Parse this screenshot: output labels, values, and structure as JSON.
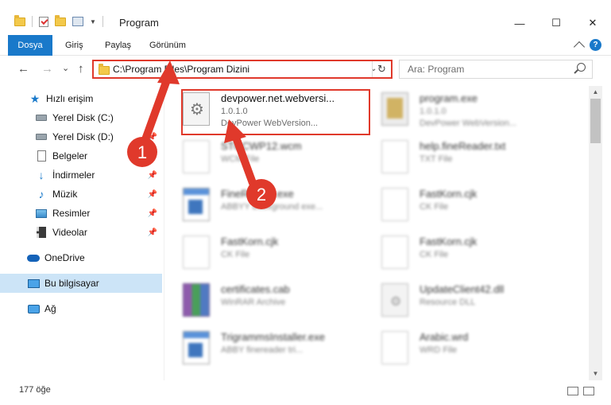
{
  "window": {
    "title": "Program",
    "minimize_label": "—",
    "maximize_label": "☐",
    "close_label": "✕"
  },
  "ribbon": {
    "tabs": [
      "Dosya",
      "Giriş",
      "Paylaş",
      "Görünüm"
    ],
    "help_label": "?"
  },
  "navigation": {
    "back_label": "←",
    "forward_label": "→",
    "recent_label": "⌄",
    "up_label": "↑",
    "address": "C:\\Program Files\\Program Dizini",
    "refresh_label": "↻",
    "dropdown_label": "⌄",
    "search_placeholder": "Ara: Program"
  },
  "sidebar": {
    "items": [
      {
        "label": "Hızlı erişim",
        "icon": "star-icon"
      },
      {
        "label": "Yerel Disk (C:)",
        "icon": "disk-icon"
      },
      {
        "label": "Yerel Disk (D:)",
        "icon": "disk-icon"
      },
      {
        "label": "Belgeler",
        "icon": "documents-icon"
      },
      {
        "label": "İndirmeler",
        "icon": "downloads-icon"
      },
      {
        "label": "Müzik",
        "icon": "music-icon"
      },
      {
        "label": "Resimler",
        "icon": "pictures-icon"
      },
      {
        "label": "Videolar",
        "icon": "videos-icon"
      },
      {
        "label": "OneDrive",
        "icon": "onedrive-icon"
      },
      {
        "label": "Bu bilgisayar",
        "icon": "computer-icon"
      },
      {
        "label": "Ağ",
        "icon": "network-icon"
      }
    ],
    "pin_label": "📌"
  },
  "files": [
    {
      "name": "devpower.net.webversi...",
      "line2": "1.0.1.0",
      "line3": "DevPower WebVersion...",
      "icon": "gears-file-icon"
    },
    {
      "name": "program.exe",
      "line2": "1.0.1.0",
      "line3": "DevPower WebVersion...",
      "icon": "exe-icon"
    },
    {
      "name": "STOCWP12.wcm",
      "line2": "WCM File",
      "line3": "",
      "icon": "generic-file-icon"
    },
    {
      "name": "help.fineReader.txt",
      "line2": "TXT File",
      "line3": "",
      "icon": "generic-file-icon"
    },
    {
      "name": "FineReader.exe",
      "line2": "ABBYY Background exe...",
      "line3": "",
      "icon": "app-icon"
    },
    {
      "name": "FastKorn.cjk",
      "line2": "CK File",
      "line3": "",
      "icon": "generic-file-icon"
    },
    {
      "name": "FastKorn.cjk",
      "line2": "CK File",
      "line3": "",
      "icon": "generic-file-icon"
    },
    {
      "name": "FastKorn.cjk",
      "line2": "CK File",
      "line3": "",
      "icon": "generic-file-icon"
    },
    {
      "name": "certificates.cab",
      "line2": "WinRAR Archive",
      "line3": "",
      "icon": "rar-icon"
    },
    {
      "name": "UpdateClient42.dll",
      "line2": "Resource DLL",
      "line3": "",
      "icon": "dll-icon"
    },
    {
      "name": "TrigrammsInstaller.exe",
      "line2": "ABBY finereader tri...",
      "line3": "",
      "icon": "app-icon"
    },
    {
      "name": "Arabic.wrd",
      "line2": "WRD File",
      "line3": "",
      "icon": "generic-file-icon"
    }
  ],
  "status": {
    "count": "177 öğe"
  },
  "annotations": {
    "step1": "1",
    "step2": "2",
    "color": "#e0392b"
  }
}
